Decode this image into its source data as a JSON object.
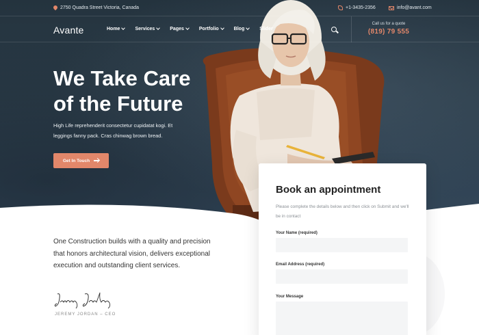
{
  "topbar": {
    "address": "2750 Quadra Street Victoria, Canada",
    "phone": "+1-3435-2356",
    "email": "info@avant.com"
  },
  "nav": {
    "logo": "Avante",
    "menu": [
      {
        "label": "Home",
        "has_dropdown": true
      },
      {
        "label": "Services",
        "has_dropdown": true
      },
      {
        "label": "Pages",
        "has_dropdown": true
      },
      {
        "label": "Portfolio",
        "has_dropdown": true
      },
      {
        "label": "Blog",
        "has_dropdown": true
      },
      {
        "label": "Slider",
        "has_dropdown": false
      }
    ],
    "quote_label": "Call us for a quote",
    "quote_number": "(819) 79 555"
  },
  "hero": {
    "headline_line1": "We Take Care",
    "headline_line2": "of the Future",
    "subtext_line1": "High Life reprehenderit consectetur cupidatat kogi. Et",
    "subtext_line2": "leggings fanny pack. Cras chinwag brown bread.",
    "cta_label": "Get In Touch"
  },
  "about": {
    "text": "One Construction builds with a quality and precision that honors architectural vision, delivers exceptional execution and outstanding client services.",
    "signature_name": "JEREMY JORDAN – CEO",
    "signature_script": "Jeremy Jordan"
  },
  "form": {
    "title": "Book an appointment",
    "description": "Please complete the details below and then click on Submit and we'll be in contact",
    "name_label": "Your Name (required)",
    "email_label": "Email Address (required)",
    "message_label": "Your Message"
  },
  "colors": {
    "accent": "#e2876a",
    "hero_bg": "#2b3c48"
  }
}
